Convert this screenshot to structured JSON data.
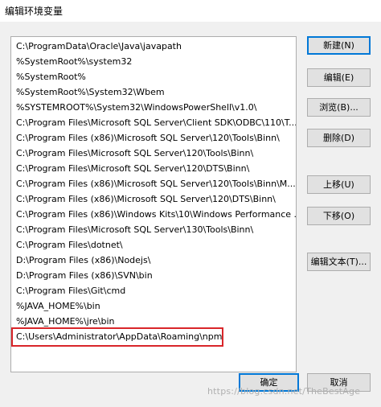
{
  "window": {
    "title": "编辑环境变量"
  },
  "path_list": {
    "items": [
      "C:\\ProgramData\\Oracle\\Java\\javapath",
      "%SystemRoot%\\system32",
      "%SystemRoot%",
      "%SystemRoot%\\System32\\Wbem",
      "%SYSTEMROOT%\\System32\\WindowsPowerShell\\v1.0\\",
      "C:\\Program Files\\Microsoft SQL Server\\Client SDK\\ODBC\\110\\T...",
      "C:\\Program Files (x86)\\Microsoft SQL Server\\120\\Tools\\Binn\\",
      "C:\\Program Files\\Microsoft SQL Server\\120\\Tools\\Binn\\",
      "C:\\Program Files\\Microsoft SQL Server\\120\\DTS\\Binn\\",
      "C:\\Program Files (x86)\\Microsoft SQL Server\\120\\Tools\\Binn\\M...",
      "C:\\Program Files (x86)\\Microsoft SQL Server\\120\\DTS\\Binn\\",
      "C:\\Program Files (x86)\\Windows Kits\\10\\Windows Performance ...",
      "C:\\Program Files\\Microsoft SQL Server\\130\\Tools\\Binn\\",
      "C:\\Program Files\\dotnet\\",
      "D:\\Program Files (x86)\\Nodejs\\",
      "D:\\Program Files (x86)\\SVN\\bin",
      "C:\\Program Files\\Git\\cmd",
      "%JAVA_HOME%\\bin",
      "%JAVA_HOME%\\jre\\bin",
      "C:\\Users\\Administrator\\AppData\\Roaming\\npm"
    ],
    "selected_index": 19
  },
  "side_buttons": {
    "new_label": "新建(N)",
    "edit_label": "编辑(E)",
    "browse_label": "浏览(B)...",
    "delete_label": "删除(D)",
    "move_up_label": "上移(U)",
    "move_down_label": "下移(O)",
    "edit_text_label": "编辑文本(T)..."
  },
  "footer": {
    "ok_label": "确定",
    "cancel_label": "取消",
    "watermark": "https://blog.csdn.net/TheBestAge"
  },
  "colors": {
    "highlight_border": "#d9262a",
    "default_button_border": "#0078d7"
  }
}
